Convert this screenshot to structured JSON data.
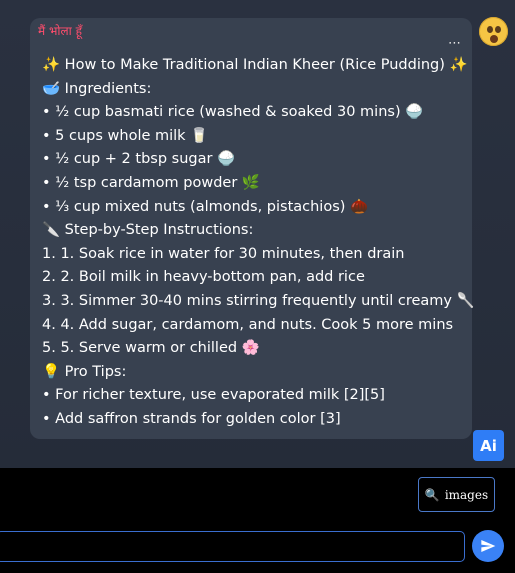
{
  "message": {
    "sender": "मैं भोला हूँ",
    "lines": [
      {
        "text": "✨ How to Make Traditional Indian Kheer (Rice Pudding) ✨"
      },
      {
        "text": "🥣 Ingredients:"
      },
      {
        "text": "• ½ cup basmati rice (washed & soaked 30 mins) 🍚"
      },
      {
        "text": "• 5 cups whole milk 🥛"
      },
      {
        "text": "• ½ cup + 2 tbsp sugar 🍚"
      },
      {
        "text": "• ½ tsp cardamom powder 🌿"
      },
      {
        "text": "• ⅓ cup mixed nuts (almonds, pistachios) 🌰"
      },
      {
        "text": "🔪 Step-by-Step Instructions:"
      },
      {
        "text": "1. 1. Soak rice in water for 30 minutes, then drain"
      },
      {
        "text": "2. 2. Boil milk in heavy-bottom pan, add rice"
      },
      {
        "text": "3. 3. Simmer 30-40 mins stirring frequently until creamy 🥄"
      },
      {
        "text": "4. 4. Add sugar, cardamom, and nuts. Cook 5 more mins"
      },
      {
        "text": "5. 5. Serve warm or chilled 🌸"
      },
      {
        "text": "💡 Pro Tips:"
      },
      {
        "text": "• For richer texture, use evaporated milk [2][5]"
      },
      {
        "text": "• Add saffron strands for golden color [3]"
      }
    ],
    "more_icon": "⋯"
  },
  "reaction_icon": "astonished-face-emoji",
  "ai_button": {
    "label": "Ai"
  },
  "images_button": {
    "label": "images",
    "icon": "🔍"
  },
  "input": {
    "value": "",
    "placeholder": ""
  },
  "colors": {
    "accent": "#3a82f6",
    "sender": "#ff4d6d",
    "bubble": "#384150"
  }
}
